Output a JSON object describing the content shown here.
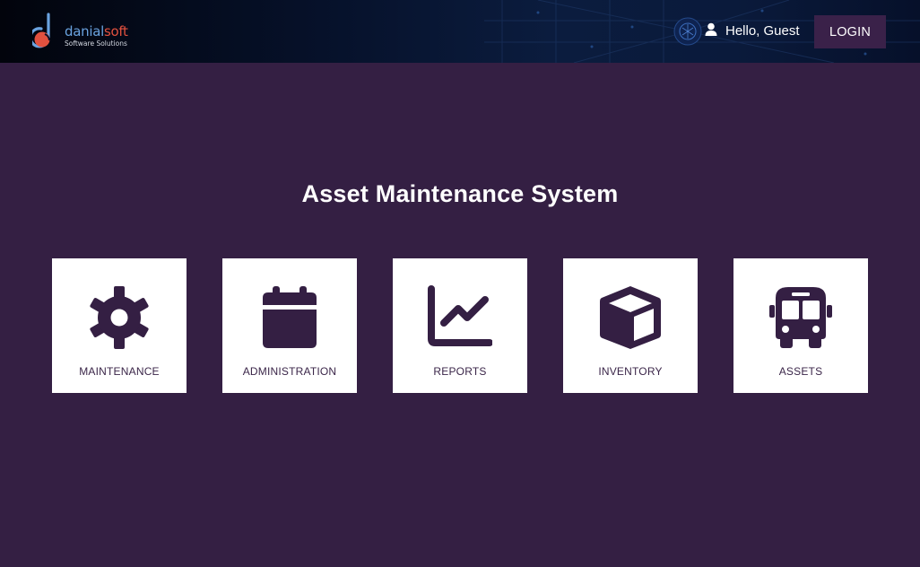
{
  "brand": {
    "name_part1": "danial",
    "name_part2": "soft",
    "tagline": "Software Solutions"
  },
  "header": {
    "greeting": "Hello, Guest",
    "login_label": "LOGIN"
  },
  "main": {
    "title": "Asset Maintenance System",
    "tiles": [
      {
        "label": "MAINTENANCE",
        "icon": "gear-icon"
      },
      {
        "label": "ADMINISTRATION",
        "icon": "calendar-icon"
      },
      {
        "label": "REPORTS",
        "icon": "line-chart-icon"
      },
      {
        "label": "INVENTORY",
        "icon": "box-icon"
      },
      {
        "label": "ASSETS",
        "icon": "bus-icon"
      }
    ]
  },
  "colors": {
    "background": "#341f43",
    "icon": "#341f43",
    "login_button": "#3a2149",
    "header": "#0a1a3b",
    "brand_blue": "#6aa3e0",
    "brand_red": "#e2513f"
  }
}
